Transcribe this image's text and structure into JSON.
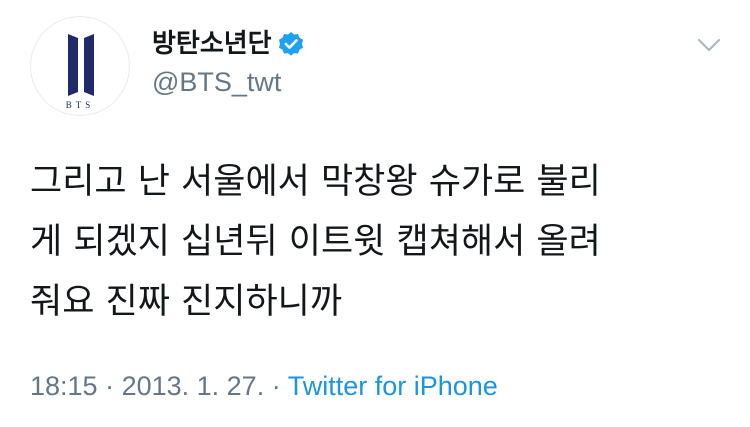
{
  "profile": {
    "display_name": "방탄소년단",
    "handle": "@BTS_twt",
    "avatar_text": "BTS",
    "verified": true
  },
  "tweet": {
    "lines": [
      "그리고 난 서울에서 막창왕 슈가로 불리",
      "게 되겠지 십년뒤 이트윗 캡쳐해서 올려",
      "줘요 진짜 진지하니까"
    ]
  },
  "meta": {
    "time": "18:15",
    "separator": " · ",
    "date": "2013. 1. 27.",
    "source": "Twitter for iPhone"
  },
  "icons": {
    "verified": "verified-badge-icon",
    "menu": "chevron-down-icon"
  },
  "colors": {
    "brand_blue": "#1da1f2",
    "logo_navy": "#1e2a69",
    "text": "#14171a",
    "muted": "#657786",
    "link": "#1b95e0"
  }
}
